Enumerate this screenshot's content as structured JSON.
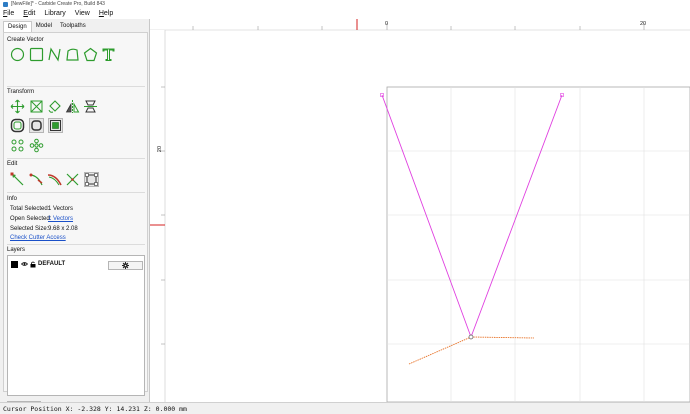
{
  "window": {
    "title": "[NewFile]* - Carbide Create Pro, Build 843"
  },
  "menu": [
    {
      "key": "F",
      "rest": "ile"
    },
    {
      "key": "E",
      "rest": "dit"
    },
    {
      "key": "",
      "rest": "Library"
    },
    {
      "key": "",
      "rest": "View"
    },
    {
      "key": "H",
      "rest": "elp"
    }
  ],
  "tabs": [
    "Design",
    "Model",
    "Toolpaths"
  ],
  "active_tab": "Design",
  "sections": {
    "create_vector": "Create Vector",
    "transform": "Transform",
    "edit": "Edit",
    "info": "Info",
    "layers": "Layers"
  },
  "icons": {
    "create_vector": [
      "circle-icon",
      "rectangle-icon",
      "polyline-icon",
      "polygon-shape-icon",
      "pentagon-icon",
      "text-icon"
    ],
    "transform_row1": [
      "move-icon",
      "scale-icon",
      "rotate-icon",
      "mirror-icon",
      "align-icon"
    ],
    "transform_row2": [
      "offset-icon",
      "fillet-icon",
      "boolean-icon"
    ],
    "transform_row3": [
      "circular-array-icon",
      "rectangular-array-icon"
    ],
    "edit": [
      "node-edit-icon",
      "trim-icon",
      "bezier-edit-icon",
      "cut-icon",
      "join-icon"
    ]
  },
  "info": {
    "total_selected_label": "Total Selected:",
    "total_selected_value": "1 Vectors",
    "open_selected_label": "Open Selected:",
    "open_selected_value": "1 Vectors",
    "selected_size_label": "Selected Size:",
    "selected_size_value": "9.68 x 2.08",
    "check_cutter_access": "Check Cutter Access"
  },
  "layers": [
    {
      "name": "DEFAULT",
      "color": "#000000"
    }
  ],
  "add_layer_label": "+",
  "ruler": {
    "top_labels": [
      "0",
      "20"
    ],
    "left_labels": [
      "20"
    ]
  },
  "colors": {
    "selected_vector": "#e040e0",
    "toolpath_preview": "#e8742a",
    "icon_green": "#2e9c2e",
    "icon_red": "#c0392b",
    "ruler_marker": "#d42020",
    "link": "#1a50c8"
  },
  "status": {
    "cursor_position": "Cursor Position X: -2.328 Y: 14.231 Z: 0.000 mm"
  }
}
